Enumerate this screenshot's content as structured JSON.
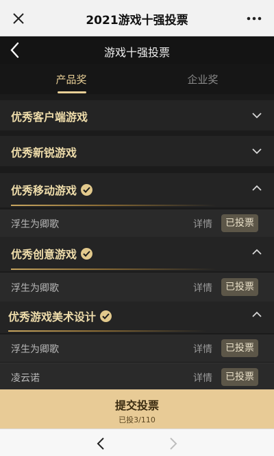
{
  "wechat_bar": {
    "title": "2021游戏十强投票"
  },
  "app_header": {
    "title": "游戏十强投票"
  },
  "tabs": [
    {
      "label": "产品奖",
      "active": true
    },
    {
      "label": "企业奖",
      "active": false
    }
  ],
  "categories": [
    {
      "label": "优秀客户端游戏",
      "expanded": false,
      "voted": false
    },
    {
      "label": "优秀新锐游戏",
      "expanded": false,
      "voted": false
    },
    {
      "label": "优秀移动游戏",
      "expanded": true,
      "voted": true,
      "items": [
        {
          "name": "浮生为卿歌",
          "detail": "详情",
          "status": "已投票"
        }
      ]
    },
    {
      "label": "优秀创意游戏",
      "expanded": true,
      "voted": true,
      "items": [
        {
          "name": "浮生为卿歌",
          "detail": "详情",
          "status": "已投票"
        }
      ]
    },
    {
      "label": "优秀游戏美术设计",
      "expanded": true,
      "voted": true,
      "items": [
        {
          "name": "浮生为卿歌",
          "detail": "详情",
          "status": "已投票"
        },
        {
          "name": "凌云诺",
          "detail": "详情",
          "status": "已投票"
        }
      ]
    }
  ],
  "submit": {
    "label": "提交投票",
    "count_text": "已投3/110"
  },
  "colors": {
    "gold": "#e8cf96",
    "panel": "#242424",
    "submit_bg": "#e8cb96"
  }
}
